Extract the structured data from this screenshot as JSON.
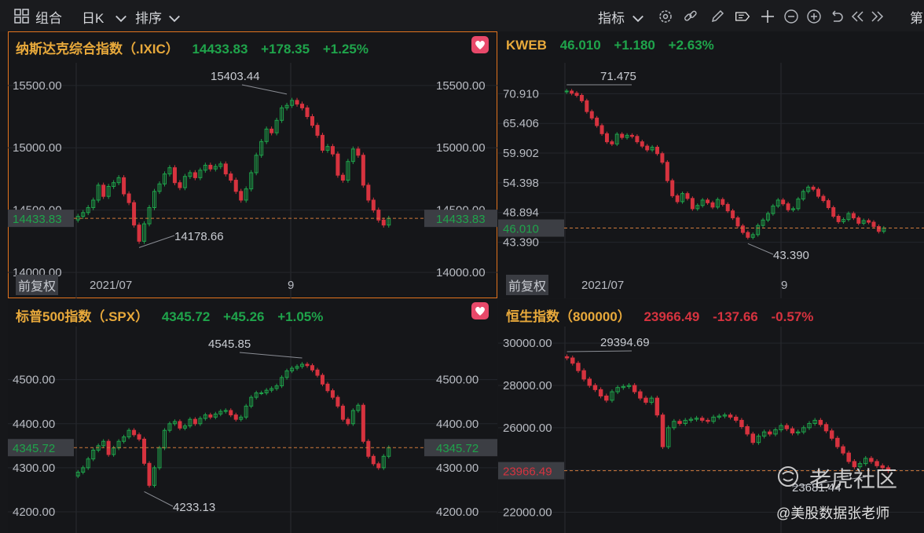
{
  "toolbar": {
    "combo": "组合",
    "period": "日K",
    "sort": "排序",
    "indicator": "指标",
    "more": "第"
  },
  "colors": {
    "up": "#1fa44b",
    "down": "#d6333f",
    "active_border": "#e2731d",
    "title_name": "#e8a93b"
  },
  "panels": [
    {
      "name": "纳斯达克综合指数（.IXIC）",
      "price": "14433.83",
      "change": "+178.35",
      "pct": "+1.25%",
      "trend": "up",
      "y_ticks": [
        "15500.00",
        "15000.00",
        "14500.00",
        "14000.00"
      ],
      "current_tag": "14433.83",
      "high_label": "15403.44",
      "low_label": "14178.66",
      "x_labels": [
        "2021/07",
        "9"
      ],
      "adj": "前复权",
      "fav": true
    },
    {
      "name": "KWEB",
      "price": "46.010",
      "change": "+1.180",
      "pct": "+2.63%",
      "trend": "up",
      "y_ticks": [
        "70.910",
        "65.406",
        "59.902",
        "54.398",
        "48.894",
        "43.390"
      ],
      "current_tag": "46.010",
      "high_label": "71.475",
      "low_label": "43.390",
      "x_labels": [
        "2021/07",
        "9"
      ],
      "adj": "前复权",
      "fav": false
    },
    {
      "name": "标普500指数（.SPX）",
      "price": "4345.72",
      "change": "+45.26",
      "pct": "+1.05%",
      "trend": "up",
      "y_ticks": [
        "4500.00",
        "4400.00",
        "4300.00",
        "4200.00"
      ],
      "current_tag": "4345.72",
      "high_label": "4545.85",
      "low_label": "4233.13",
      "x_labels": [],
      "adj": "",
      "fav": true
    },
    {
      "name": "恒生指数（800000）",
      "price": "23966.49",
      "change": "-137.66",
      "pct": "-0.57%",
      "trend": "down",
      "y_ticks": [
        "30000.00",
        "28000.00",
        "26000.00",
        "24000.00",
        "22000.00"
      ],
      "current_tag": "23966.49",
      "high_label": "29394.69",
      "low_label": "23681.44",
      "x_labels": [],
      "adj": "",
      "fav": false
    }
  ],
  "watermark": {
    "brand": "老虎社区",
    "author": "@美股数据张老师"
  },
  "chart_data": [
    {
      "type": "candlestick",
      "title": "纳斯达克综合指数（.IXIC）",
      "ylim": [
        13950,
        15650
      ],
      "close": [
        14450,
        14480,
        14520,
        14580,
        14700,
        14610,
        14690,
        14720,
        14760,
        14630,
        14560,
        14380,
        14250,
        14390,
        14520,
        14650,
        14710,
        14790,
        14840,
        14720,
        14680,
        14770,
        14800,
        14760,
        14820,
        14860,
        14830,
        14850,
        14870,
        14790,
        14740,
        14650,
        14580,
        14670,
        14800,
        14940,
        15050,
        15150,
        15120,
        15220,
        15320,
        15340,
        15380,
        15350,
        15320,
        15250,
        15180,
        15100,
        14980,
        15010,
        14950,
        14780,
        14740,
        14890,
        14990,
        14940,
        14700,
        14580,
        14500,
        14420,
        14380,
        14433.83
      ]
    },
    {
      "type": "candlestick",
      "title": "KWEB",
      "ylim": [
        41,
        73
      ],
      "close": [
        71.4,
        71,
        70.6,
        69.6,
        67.6,
        66.4,
        65,
        63.5,
        62,
        61.6,
        63.4,
        62.8,
        63.2,
        63,
        62,
        61.2,
        60.5,
        61,
        59.8,
        58.2,
        54.8,
        52,
        50.9,
        52.4,
        51.5,
        49.6,
        50.2,
        51.2,
        50.7,
        49.9,
        51.3,
        50.4,
        49.2,
        47.9,
        46.4,
        45.2,
        44.3,
        44.8,
        46.5,
        47.5,
        48.7,
        50.1,
        51.2,
        50.5,
        49.4,
        49.6,
        51.4,
        52.8,
        53.6,
        53.2,
        51.9,
        51.1,
        49.8,
        48.2,
        47.2,
        47.6,
        48.7,
        47.9,
        46.9,
        47.4,
        47.1,
        46.3,
        45.4,
        46.01
      ]
    },
    {
      "type": "candlestick",
      "title": "标普500指数（.SPX）",
      "ylim": [
        4175,
        4585
      ],
      "close": [
        4290,
        4300,
        4320,
        4340,
        4350,
        4360,
        4330,
        4345,
        4360,
        4370,
        4385,
        4375,
        4365,
        4310,
        4260,
        4300,
        4345,
        4385,
        4400,
        4405,
        4390,
        4395,
        4410,
        4400,
        4412,
        4420,
        4415,
        4422,
        4428,
        4430,
        4420,
        4410,
        4415,
        4440,
        4460,
        4470,
        4470,
        4476,
        4480,
        4486,
        4505,
        4520,
        4526,
        4530,
        4535,
        4532,
        4522,
        4510,
        4490,
        4475,
        4460,
        4440,
        4410,
        4400,
        4430,
        4442,
        4360,
        4326,
        4309,
        4300,
        4326,
        4345.72
      ]
    },
    {
      "type": "candlestick",
      "title": "恒生指数（800000）",
      "ylim": [
        21500,
        30600
      ],
      "close": [
        29300,
        29050,
        28700,
        28300,
        28000,
        27800,
        27500,
        27300,
        27700,
        27900,
        27950,
        28000,
        27700,
        27400,
        27200,
        27400,
        26600,
        25100,
        26000,
        26300,
        26200,
        26350,
        26400,
        26450,
        26350,
        26300,
        26500,
        26550,
        26600,
        26500,
        26350,
        26050,
        25700,
        25300,
        25600,
        25800,
        25700,
        25900,
        26100,
        25950,
        25750,
        25800,
        26000,
        26200,
        26350,
        26150,
        25850,
        25500,
        25100,
        24800,
        24400,
        24150,
        24300,
        24550,
        24400,
        24200,
        24104.15,
        23966.49
      ]
    }
  ]
}
